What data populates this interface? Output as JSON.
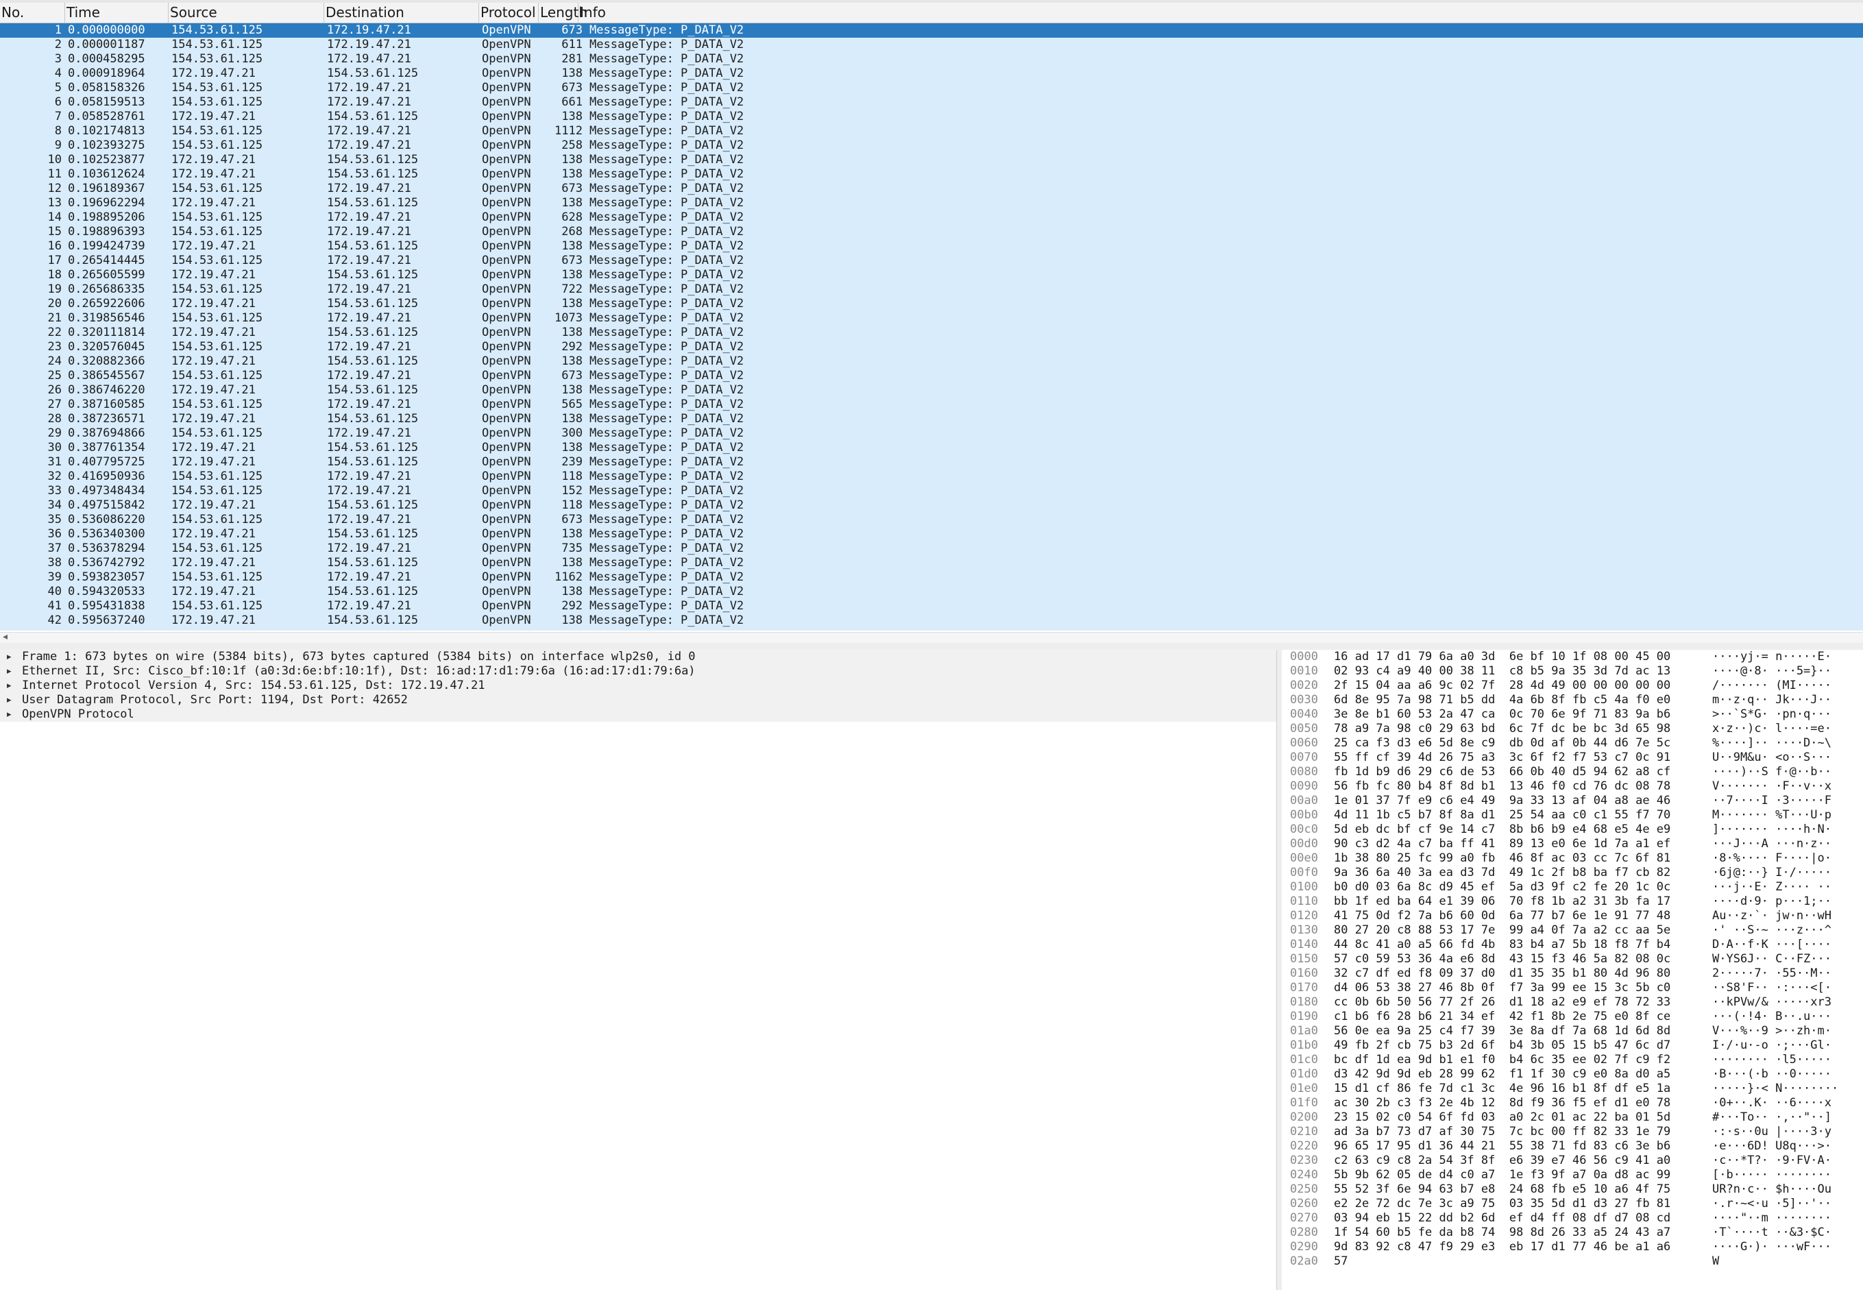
{
  "columns": {
    "no": "No.",
    "time": "Time",
    "source": "Source",
    "destination": "Destination",
    "protocol": "Protocol",
    "length": "Length",
    "info": "Info"
  },
  "packets": [
    {
      "no": "1",
      "time": "0.000000000",
      "src": "154.53.61.125",
      "dst": "172.19.47.21",
      "proto": "OpenVPN",
      "len": "673",
      "info": "MessageType: P_DATA_V2"
    },
    {
      "no": "2",
      "time": "0.000001187",
      "src": "154.53.61.125",
      "dst": "172.19.47.21",
      "proto": "OpenVPN",
      "len": "611",
      "info": "MessageType: P_DATA_V2"
    },
    {
      "no": "3",
      "time": "0.000458295",
      "src": "154.53.61.125",
      "dst": "172.19.47.21",
      "proto": "OpenVPN",
      "len": "281",
      "info": "MessageType: P_DATA_V2"
    },
    {
      "no": "4",
      "time": "0.000918964",
      "src": "172.19.47.21",
      "dst": "154.53.61.125",
      "proto": "OpenVPN",
      "len": "138",
      "info": "MessageType: P_DATA_V2"
    },
    {
      "no": "5",
      "time": "0.058158326",
      "src": "154.53.61.125",
      "dst": "172.19.47.21",
      "proto": "OpenVPN",
      "len": "673",
      "info": "MessageType: P_DATA_V2"
    },
    {
      "no": "6",
      "time": "0.058159513",
      "src": "154.53.61.125",
      "dst": "172.19.47.21",
      "proto": "OpenVPN",
      "len": "661",
      "info": "MessageType: P_DATA_V2"
    },
    {
      "no": "7",
      "time": "0.058528761",
      "src": "172.19.47.21",
      "dst": "154.53.61.125",
      "proto": "OpenVPN",
      "len": "138",
      "info": "MessageType: P_DATA_V2"
    },
    {
      "no": "8",
      "time": "0.102174813",
      "src": "154.53.61.125",
      "dst": "172.19.47.21",
      "proto": "OpenVPN",
      "len": "1112",
      "info": "MessageType: P_DATA_V2"
    },
    {
      "no": "9",
      "time": "0.102393275",
      "src": "154.53.61.125",
      "dst": "172.19.47.21",
      "proto": "OpenVPN",
      "len": "258",
      "info": "MessageType: P_DATA_V2"
    },
    {
      "no": "10",
      "time": "0.102523877",
      "src": "172.19.47.21",
      "dst": "154.53.61.125",
      "proto": "OpenVPN",
      "len": "138",
      "info": "MessageType: P_DATA_V2"
    },
    {
      "no": "11",
      "time": "0.103612624",
      "src": "172.19.47.21",
      "dst": "154.53.61.125",
      "proto": "OpenVPN",
      "len": "138",
      "info": "MessageType: P_DATA_V2"
    },
    {
      "no": "12",
      "time": "0.196189367",
      "src": "154.53.61.125",
      "dst": "172.19.47.21",
      "proto": "OpenVPN",
      "len": "673",
      "info": "MessageType: P_DATA_V2"
    },
    {
      "no": "13",
      "time": "0.196962294",
      "src": "172.19.47.21",
      "dst": "154.53.61.125",
      "proto": "OpenVPN",
      "len": "138",
      "info": "MessageType: P_DATA_V2"
    },
    {
      "no": "14",
      "time": "0.198895206",
      "src": "154.53.61.125",
      "dst": "172.19.47.21",
      "proto": "OpenVPN",
      "len": "628",
      "info": "MessageType: P_DATA_V2"
    },
    {
      "no": "15",
      "time": "0.198896393",
      "src": "154.53.61.125",
      "dst": "172.19.47.21",
      "proto": "OpenVPN",
      "len": "268",
      "info": "MessageType: P_DATA_V2"
    },
    {
      "no": "16",
      "time": "0.199424739",
      "src": "172.19.47.21",
      "dst": "154.53.61.125",
      "proto": "OpenVPN",
      "len": "138",
      "info": "MessageType: P_DATA_V2"
    },
    {
      "no": "17",
      "time": "0.265414445",
      "src": "154.53.61.125",
      "dst": "172.19.47.21",
      "proto": "OpenVPN",
      "len": "673",
      "info": "MessageType: P_DATA_V2"
    },
    {
      "no": "18",
      "time": "0.265605599",
      "src": "172.19.47.21",
      "dst": "154.53.61.125",
      "proto": "OpenVPN",
      "len": "138",
      "info": "MessageType: P_DATA_V2"
    },
    {
      "no": "19",
      "time": "0.265686335",
      "src": "154.53.61.125",
      "dst": "172.19.47.21",
      "proto": "OpenVPN",
      "len": "722",
      "info": "MessageType: P_DATA_V2"
    },
    {
      "no": "20",
      "time": "0.265922606",
      "src": "172.19.47.21",
      "dst": "154.53.61.125",
      "proto": "OpenVPN",
      "len": "138",
      "info": "MessageType: P_DATA_V2"
    },
    {
      "no": "21",
      "time": "0.319856546",
      "src": "154.53.61.125",
      "dst": "172.19.47.21",
      "proto": "OpenVPN",
      "len": "1073",
      "info": "MessageType: P_DATA_V2"
    },
    {
      "no": "22",
      "time": "0.320111814",
      "src": "172.19.47.21",
      "dst": "154.53.61.125",
      "proto": "OpenVPN",
      "len": "138",
      "info": "MessageType: P_DATA_V2"
    },
    {
      "no": "23",
      "time": "0.320576045",
      "src": "154.53.61.125",
      "dst": "172.19.47.21",
      "proto": "OpenVPN",
      "len": "292",
      "info": "MessageType: P_DATA_V2"
    },
    {
      "no": "24",
      "time": "0.320882366",
      "src": "172.19.47.21",
      "dst": "154.53.61.125",
      "proto": "OpenVPN",
      "len": "138",
      "info": "MessageType: P_DATA_V2"
    },
    {
      "no": "25",
      "time": "0.386545567",
      "src": "154.53.61.125",
      "dst": "172.19.47.21",
      "proto": "OpenVPN",
      "len": "673",
      "info": "MessageType: P_DATA_V2"
    },
    {
      "no": "26",
      "time": "0.386746220",
      "src": "172.19.47.21",
      "dst": "154.53.61.125",
      "proto": "OpenVPN",
      "len": "138",
      "info": "MessageType: P_DATA_V2"
    },
    {
      "no": "27",
      "time": "0.387160585",
      "src": "154.53.61.125",
      "dst": "172.19.47.21",
      "proto": "OpenVPN",
      "len": "565",
      "info": "MessageType: P_DATA_V2"
    },
    {
      "no": "28",
      "time": "0.387236571",
      "src": "172.19.47.21",
      "dst": "154.53.61.125",
      "proto": "OpenVPN",
      "len": "138",
      "info": "MessageType: P_DATA_V2"
    },
    {
      "no": "29",
      "time": "0.387694866",
      "src": "154.53.61.125",
      "dst": "172.19.47.21",
      "proto": "OpenVPN",
      "len": "300",
      "info": "MessageType: P_DATA_V2"
    },
    {
      "no": "30",
      "time": "0.387761354",
      "src": "172.19.47.21",
      "dst": "154.53.61.125",
      "proto": "OpenVPN",
      "len": "138",
      "info": "MessageType: P_DATA_V2"
    },
    {
      "no": "31",
      "time": "0.407795725",
      "src": "172.19.47.21",
      "dst": "154.53.61.125",
      "proto": "OpenVPN",
      "len": "239",
      "info": "MessageType: P_DATA_V2"
    },
    {
      "no": "32",
      "time": "0.416950936",
      "src": "154.53.61.125",
      "dst": "172.19.47.21",
      "proto": "OpenVPN",
      "len": "118",
      "info": "MessageType: P_DATA_V2"
    },
    {
      "no": "33",
      "time": "0.497348434",
      "src": "154.53.61.125",
      "dst": "172.19.47.21",
      "proto": "OpenVPN",
      "len": "152",
      "info": "MessageType: P_DATA_V2"
    },
    {
      "no": "34",
      "time": "0.497515842",
      "src": "172.19.47.21",
      "dst": "154.53.61.125",
      "proto": "OpenVPN",
      "len": "118",
      "info": "MessageType: P_DATA_V2"
    },
    {
      "no": "35",
      "time": "0.536086220",
      "src": "154.53.61.125",
      "dst": "172.19.47.21",
      "proto": "OpenVPN",
      "len": "673",
      "info": "MessageType: P_DATA_V2"
    },
    {
      "no": "36",
      "time": "0.536340300",
      "src": "172.19.47.21",
      "dst": "154.53.61.125",
      "proto": "OpenVPN",
      "len": "138",
      "info": "MessageType: P_DATA_V2"
    },
    {
      "no": "37",
      "time": "0.536378294",
      "src": "154.53.61.125",
      "dst": "172.19.47.21",
      "proto": "OpenVPN",
      "len": "735",
      "info": "MessageType: P_DATA_V2"
    },
    {
      "no": "38",
      "time": "0.536742792",
      "src": "172.19.47.21",
      "dst": "154.53.61.125",
      "proto": "OpenVPN",
      "len": "138",
      "info": "MessageType: P_DATA_V2"
    },
    {
      "no": "39",
      "time": "0.593823057",
      "src": "154.53.61.125",
      "dst": "172.19.47.21",
      "proto": "OpenVPN",
      "len": "1162",
      "info": "MessageType: P_DATA_V2"
    },
    {
      "no": "40",
      "time": "0.594320533",
      "src": "172.19.47.21",
      "dst": "154.53.61.125",
      "proto": "OpenVPN",
      "len": "138",
      "info": "MessageType: P_DATA_V2"
    },
    {
      "no": "41",
      "time": "0.595431838",
      "src": "154.53.61.125",
      "dst": "172.19.47.21",
      "proto": "OpenVPN",
      "len": "292",
      "info": "MessageType: P_DATA_V2"
    },
    {
      "no": "42",
      "time": "0.595637240",
      "src": "172.19.47.21",
      "dst": "154.53.61.125",
      "proto": "OpenVPN",
      "len": "138",
      "info": "MessageType: P_DATA_V2"
    }
  ],
  "details": [
    "Frame 1: 673 bytes on wire (5384 bits), 673 bytes captured (5384 bits) on interface wlp2s0, id 0",
    "Ethernet II, Src: Cisco_bf:10:1f (a0:3d:6e:bf:10:1f), Dst: 16:ad:17:d1:79:6a (16:ad:17:d1:79:6a)",
    "Internet Protocol Version 4, Src: 154.53.61.125, Dst: 172.19.47.21",
    "User Datagram Protocol, Src Port: 1194, Dst Port: 42652",
    "OpenVPN Protocol"
  ],
  "bytes": [
    {
      "off": "0000",
      "hex": "16 ad 17 d1 79 6a a0 3d  6e bf 10 1f 08 00 45 00",
      "ascii": "····yj·= n·····E·"
    },
    {
      "off": "0010",
      "hex": "02 93 c4 a9 40 00 38 11  c8 b5 9a 35 3d 7d ac 13",
      "ascii": "····@·8· ···5=}··"
    },
    {
      "off": "0020",
      "hex": "2f 15 04 aa a6 9c 02 7f  28 4d 49 00 00 00 00 00",
      "ascii": "/······· (MI·····"
    },
    {
      "off": "0030",
      "hex": "6d 8e 95 7a 98 71 b5 dd  4a 6b 8f fb c5 4a f0 e0",
      "ascii": "m··z·q·· Jk···J··"
    },
    {
      "off": "0040",
      "hex": "3e 8e b1 60 53 2a 47 ca  0c 70 6e 9f 71 83 9a b6",
      "ascii": ">··`S*G· ·pn·q···"
    },
    {
      "off": "0050",
      "hex": "78 a9 7a 98 c0 29 63 bd  6c 7f dc be bc 3d 65 98",
      "ascii": "x·z··)c· l····=e·"
    },
    {
      "off": "0060",
      "hex": "25 ca f3 d3 e6 5d 8e c9  db 0d af 0b 44 d6 7e 5c",
      "ascii": "%····]·· ····D·~\\"
    },
    {
      "off": "0070",
      "hex": "55 ff cf 39 4d 26 75 a3  3c 6f f2 f7 53 c7 0c 91",
      "ascii": "U··9M&u· <o··S···"
    },
    {
      "off": "0080",
      "hex": "fb 1d b9 d6 29 c6 de 53  66 0b 40 d5 94 62 a8 cf",
      "ascii": "····)··S f·@··b··"
    },
    {
      "off": "0090",
      "hex": "56 fb fc 80 b4 8f 8d b1  13 46 f0 cd 76 dc 08 78",
      "ascii": "V······· ·F··v··x"
    },
    {
      "off": "00a0",
      "hex": "1e 01 37 7f e9 c6 e4 49  9a 33 13 af 04 a8 ae 46",
      "ascii": "··7····I ·3·····F"
    },
    {
      "off": "00b0",
      "hex": "4d 11 1b c5 b7 8f 8a d1  25 54 aa c0 c1 55 f7 70",
      "ascii": "M······· %T···U·p"
    },
    {
      "off": "00c0",
      "hex": "5d eb dc bf cf 9e 14 c7  8b b6 b9 e4 68 e5 4e e9",
      "ascii": "]······· ····h·N·"
    },
    {
      "off": "00d0",
      "hex": "90 c3 d2 4a c7 ba ff 41  89 13 e0 6e 1d 7a a1 ef",
      "ascii": "···J···A ···n·z··"
    },
    {
      "off": "00e0",
      "hex": "1b 38 80 25 fc 99 a0 fb  46 8f ac 03 cc 7c 6f 81",
      "ascii": "·8·%···· F····|o·"
    },
    {
      "off": "00f0",
      "hex": "9a 36 6a 40 3a ea d3 7d  49 1c 2f b8 ba f7 cb 82",
      "ascii": "·6j@:··} I·/·····"
    },
    {
      "off": "0100",
      "hex": "b0 d0 03 6a 8c d9 45 ef  5a d3 9f c2 fe 20 1c 0c",
      "ascii": "···j··E· Z···· ··"
    },
    {
      "off": "0110",
      "hex": "bb 1f ed ba 64 e1 39 06  70 f8 1b a2 31 3b fa 17",
      "ascii": "····d·9· p···1;··"
    },
    {
      "off": "0120",
      "hex": "41 75 0d f2 7a b6 60 0d  6a 77 b7 6e 1e 91 77 48",
      "ascii": "Au··z·`· jw·n··wH"
    },
    {
      "off": "0130",
      "hex": "80 27 20 c8 88 53 17 7e  99 a4 0f 7a a2 cc aa 5e",
      "ascii": "·' ··S·~ ···z···^"
    },
    {
      "off": "0140",
      "hex": "44 8c 41 a0 a5 66 fd 4b  83 b4 a7 5b 18 f8 7f b4",
      "ascii": "D·A··f·K ···[····"
    },
    {
      "off": "0150",
      "hex": "57 c0 59 53 36 4a e6 8d  43 15 f3 46 5a 82 08 0c",
      "ascii": "W·YS6J·· C··FZ···"
    },
    {
      "off": "0160",
      "hex": "32 c7 df ed f8 09 37 d0  d1 35 35 b1 80 4d 96 80",
      "ascii": "2·····7· ·55··M··"
    },
    {
      "off": "0170",
      "hex": "d4 06 53 38 27 46 8b 0f  f7 3a 99 ee 15 3c 5b c0",
      "ascii": "··S8'F·· ·:···<[·"
    },
    {
      "off": "0180",
      "hex": "cc 0b 6b 50 56 77 2f 26  d1 18 a2 e9 ef 78 72 33",
      "ascii": "··kPVw/& ·····xr3"
    },
    {
      "off": "0190",
      "hex": "c1 b6 f6 28 b6 21 34 ef  42 f1 8b 2e 75 e0 8f ce",
      "ascii": "···(·!4· B··.u···"
    },
    {
      "off": "01a0",
      "hex": "56 0e ea 9a 25 c4 f7 39  3e 8a df 7a 68 1d 6d 8d",
      "ascii": "V···%··9 >··zh·m·"
    },
    {
      "off": "01b0",
      "hex": "49 fb 2f cb 75 b3 2d 6f  b4 3b 05 15 b5 47 6c d7",
      "ascii": "I·/·u·-o ·;···Gl·"
    },
    {
      "off": "01c0",
      "hex": "bc df 1d ea 9d b1 e1 f0  b4 6c 35 ee 02 7f c9 f2",
      "ascii": "········ ·l5·····"
    },
    {
      "off": "01d0",
      "hex": "d3 42 9d 9d eb 28 99 62  f1 1f 30 c9 e0 8a d0 a5",
      "ascii": "·B···(·b ··0·····"
    },
    {
      "off": "01e0",
      "hex": "15 d1 cf 86 fe 7d c1 3c  4e 96 16 b1 8f df e5 1a",
      "ascii": "·····}·< N········"
    },
    {
      "off": "01f0",
      "hex": "ac 30 2b c3 f3 2e 4b 12  8d f9 36 f5 ef d1 e0 78",
      "ascii": "·0+··.K· ··6····x"
    },
    {
      "off": "0200",
      "hex": "23 15 02 c0 54 6f fd 03  a0 2c 01 ac 22 ba 01 5d",
      "ascii": "#···To·· ·,··\"··]"
    },
    {
      "off": "0210",
      "hex": "ad 3a b7 73 d7 af 30 75  7c bc 00 ff 82 33 1e 79",
      "ascii": "·:·s··0u |····3·y"
    },
    {
      "off": "0220",
      "hex": "96 65 17 95 d1 36 44 21  55 38 71 fd 83 c6 3e b6",
      "ascii": "·e···6D! U8q···>·"
    },
    {
      "off": "0230",
      "hex": "c2 63 c9 c8 2a 54 3f 8f  e6 39 e7 46 56 c9 41 a0",
      "ascii": "·c··*T?· ·9·FV·A·"
    },
    {
      "off": "0240",
      "hex": "5b 9b 62 05 de d4 c0 a7  1e f3 9f a7 0a d8 ac 99",
      "ascii": "[·b····· ········"
    },
    {
      "off": "0250",
      "hex": "55 52 3f 6e 94 63 b7 e8  24 68 fb e5 10 a6 4f 75",
      "ascii": "UR?n·c·· $h····Ou"
    },
    {
      "off": "0260",
      "hex": "e2 2e 72 dc 7e 3c a9 75  03 35 5d d1 d3 27 fb 81",
      "ascii": "·.r·~<·u ·5]··'··"
    },
    {
      "off": "0270",
      "hex": "03 94 eb 15 22 dd b2 6d  ef d4 ff 08 df d7 08 cd",
      "ascii": "····\"··m ········"
    },
    {
      "off": "0280",
      "hex": "1f 54 60 b5 fe da b8 74  98 8d 26 33 a5 24 43 a7",
      "ascii": "·T`····t ··&3·$C·"
    },
    {
      "off": "0290",
      "hex": "9d 83 92 c8 47 f9 29 e3  eb 17 d1 77 46 be a1 a6",
      "ascii": "····G·)· ···wF···"
    },
    {
      "off": "02a0",
      "hex": "57",
      "ascii": "W"
    }
  ],
  "colors": {
    "selected": "#2a7bbf",
    "row_bg": "#d8ecfb"
  },
  "icons": {
    "expander": "triangle-right-icon",
    "scroll_left": "arrow-left-icon"
  }
}
